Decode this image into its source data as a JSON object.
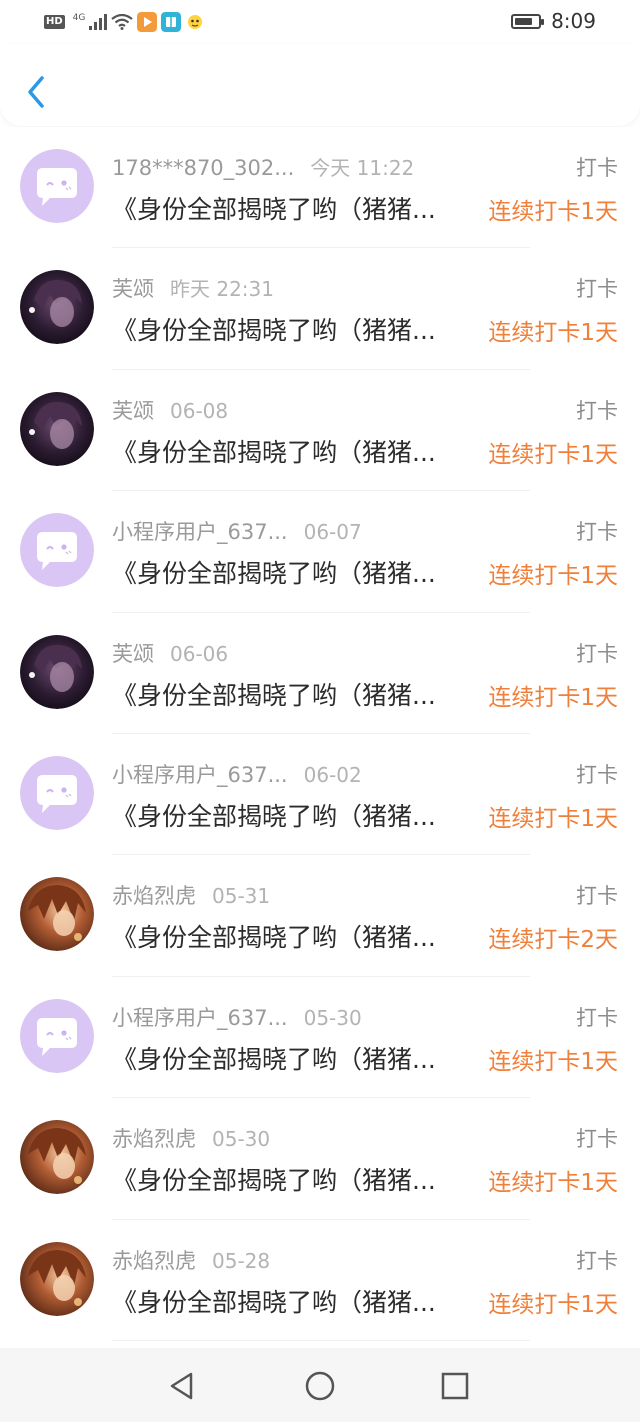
{
  "status_bar": {
    "left_icons": [
      "hd-badge",
      "4g-signal-icon",
      "signal-bars-icon",
      "wifi-icon",
      "app-video-icon",
      "app-book-icon",
      "app-mascot-icon"
    ],
    "hd_label": "HD",
    "network_label": "4G",
    "time": "8:09",
    "battery_level": 0.75
  },
  "header": {
    "back_icon": "chevron-left-icon",
    "accent": "#2a9ae8"
  },
  "list": {
    "items": [
      {
        "name": "178***870_302...",
        "date": "今天 11:22",
        "tag": "打卡",
        "title": "《身份全部揭晓了哟（猪猪...",
        "streak": "连续打卡1天",
        "avatar": "bubble"
      },
      {
        "name": "芙颂",
        "date": "昨天 22:31",
        "tag": "打卡",
        "title": "《身份全部揭晓了哟（猪猪...",
        "streak": "连续打卡1天",
        "avatar": "dark"
      },
      {
        "name": "芙颂",
        "date": "06-08",
        "tag": "打卡",
        "title": "《身份全部揭晓了哟（猪猪...",
        "streak": "连续打卡1天",
        "avatar": "dark"
      },
      {
        "name": "小程序用户_637...",
        "date": "06-07",
        "tag": "打卡",
        "title": "《身份全部揭晓了哟（猪猪...",
        "streak": "连续打卡1天",
        "avatar": "bubble"
      },
      {
        "name": "芙颂",
        "date": "06-06",
        "tag": "打卡",
        "title": "《身份全部揭晓了哟（猪猪...",
        "streak": "连续打卡1天",
        "avatar": "dark"
      },
      {
        "name": "小程序用户_637...",
        "date": "06-02",
        "tag": "打卡",
        "title": "《身份全部揭晓了哟（猪猪...",
        "streak": "连续打卡1天",
        "avatar": "bubble"
      },
      {
        "name": "赤焰烈虎",
        "date": "05-31",
        "tag": "打卡",
        "title": "《身份全部揭晓了哟（猪猪...",
        "streak": "连续打卡2天",
        "avatar": "warm"
      },
      {
        "name": "小程序用户_637...",
        "date": "05-30",
        "tag": "打卡",
        "title": "《身份全部揭晓了哟（猪猪...",
        "streak": "连续打卡1天",
        "avatar": "bubble"
      },
      {
        "name": "赤焰烈虎",
        "date": "05-30",
        "tag": "打卡",
        "title": "《身份全部揭晓了哟（猪猪...",
        "streak": "连续打卡1天",
        "avatar": "warm"
      },
      {
        "name": "赤焰烈虎",
        "date": "05-28",
        "tag": "打卡",
        "title": "《身份全部揭晓了哟（猪猪...",
        "streak": "连续打卡1天",
        "avatar": "warm"
      }
    ]
  },
  "colors": {
    "streak": "#f07f3a",
    "default_avatar_bg": "#d9c6f5",
    "nav_bg": "#f6f6f6"
  },
  "nav_bar": {
    "icons": [
      "back-triangle-icon",
      "home-circle-icon",
      "recents-square-icon"
    ]
  }
}
